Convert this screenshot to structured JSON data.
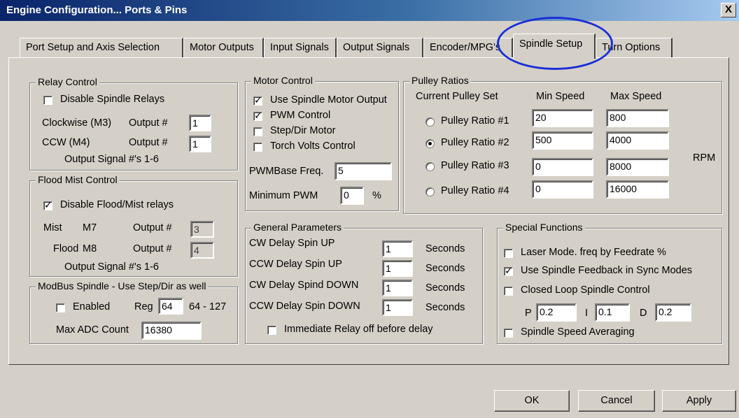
{
  "title": "Engine Configuration... Ports & Pins",
  "close_glyph": "X",
  "tabs": [
    "Port Setup and Axis Selection",
    "Motor Outputs",
    "Input Signals",
    "Output Signals",
    "Encoder/MPG's",
    "Spindle Setup",
    "Turn Options"
  ],
  "active_tab": "Spindle Setup",
  "relay": {
    "legend": "Relay Control",
    "disable_label": "Disable Spindle Relays",
    "disable_checked": false,
    "cw_label": "Clockwise (M3)",
    "cw_output_label": "Output #",
    "cw_value": "1",
    "ccw_label": "CCW (M4)",
    "ccw_output_label": "Output #",
    "ccw_value": "1",
    "note": "Output Signal #'s 1-6"
  },
  "flood": {
    "legend": "Flood Mist Control",
    "disable_label": "Disable Flood/Mist relays",
    "disable_checked": true,
    "mist_label": "Mist",
    "mist_code": "M7",
    "mist_output_label": "Output #",
    "mist_value": "3",
    "flood_label": "Flood",
    "flood_code": "M8",
    "flood_output_label": "Output #",
    "flood_value": "4",
    "note": "Output Signal #'s 1-6"
  },
  "modbus": {
    "legend": "ModBus Spindle - Use Step/Dir as well",
    "enabled_label": "Enabled",
    "enabled_checked": false,
    "reg_label": "Reg",
    "reg_value": "64",
    "reg_range": "64 - 127",
    "max_adc_label": "Max ADC Count",
    "max_adc_value": "16380"
  },
  "motor": {
    "legend": "Motor Control",
    "use_spindle_label": "Use Spindle Motor Output",
    "use_spindle_checked": true,
    "pwm_label": "PWM Control",
    "pwm_checked": true,
    "stepdir_label": "Step/Dir Motor",
    "stepdir_checked": false,
    "torch_label": "Torch Volts Control",
    "torch_checked": false,
    "pwm_base_label": "PWMBase Freq.",
    "pwm_base_value": "5",
    "min_pwm_label": "Minimum PWM",
    "min_pwm_value": "0",
    "min_pwm_unit": "%"
  },
  "pulley": {
    "legend": "Pulley Ratios",
    "current_set_label": "Current Pulley Set",
    "min_header": "Min Speed",
    "max_header": "Max Speed",
    "rpm_label": "RPM",
    "selected_index": 1,
    "rows": [
      {
        "label": "Pulley Ratio #1",
        "min": "20",
        "max": "800"
      },
      {
        "label": "Pulley Ratio #2",
        "min": "500",
        "max": "4000"
      },
      {
        "label": "Pulley Ratio #3",
        "min": "0",
        "max": "8000"
      },
      {
        "label": "Pulley Ratio #4",
        "min": "0",
        "max": "16000"
      }
    ]
  },
  "general": {
    "legend": "General Parameters",
    "unit": "Seconds",
    "rows": [
      {
        "label": "CW Delay Spin UP",
        "value": "1"
      },
      {
        "label": "CCW Delay Spin UP",
        "value": "1"
      },
      {
        "label": "CW Delay Spind DOWN",
        "value": "1"
      },
      {
        "label": "CCW Delay Spin DOWN",
        "value": "1"
      }
    ],
    "immediate_label": "Immediate Relay off before delay",
    "immediate_checked": false
  },
  "special": {
    "legend": "Special Functions",
    "laser_label": "Laser Mode. freq by Feedrate %",
    "laser_checked": false,
    "feedback_label": "Use Spindle Feedback in Sync Modes",
    "feedback_checked": true,
    "closed_loop_label": "Closed Loop Spindle Control",
    "closed_loop_checked": false,
    "p_label": "P",
    "p_value": "0.2",
    "i_label": "I",
    "i_value": "0.1",
    "d_label": "D",
    "d_value": "0.2",
    "averaging_label": "Spindle Speed Averaging",
    "averaging_checked": false
  },
  "buttons": {
    "ok": "OK",
    "cancel": "Cancel",
    "apply": "Apply"
  },
  "highlight_color": "#1a2fd8"
}
